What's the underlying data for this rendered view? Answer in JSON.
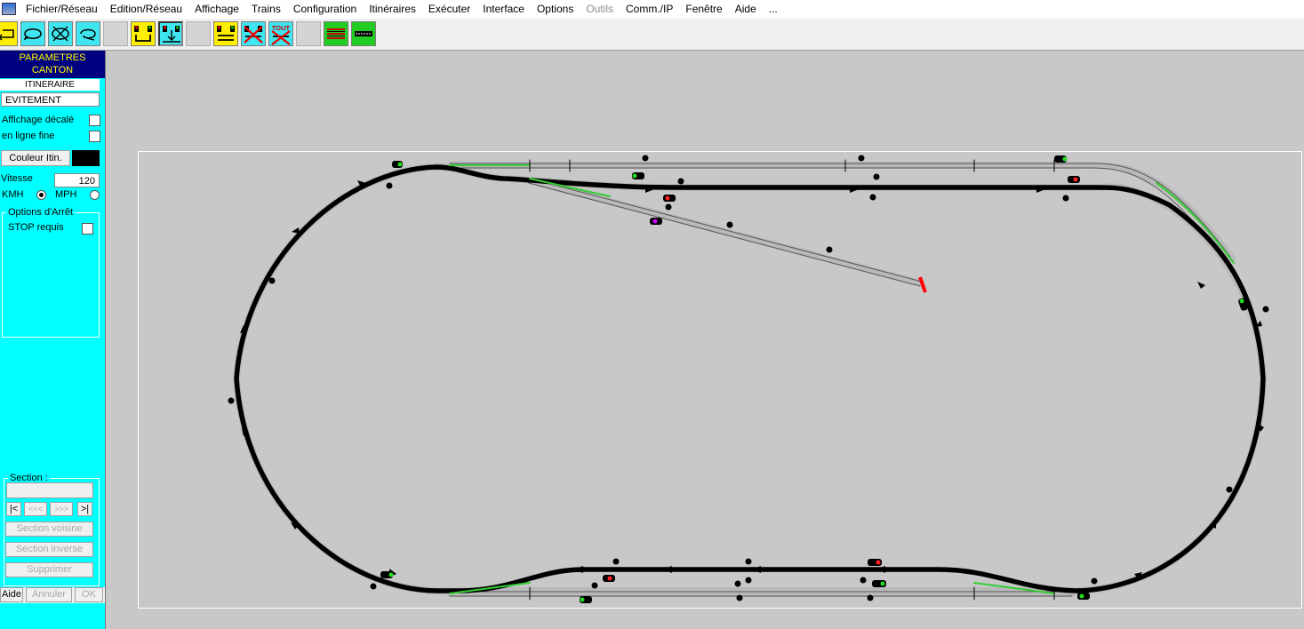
{
  "menu": [
    "Fichier/Réseau",
    "Edition/Réseau",
    "Affichage",
    "Trains",
    "Configuration",
    "Itinéraires",
    "Exécuter",
    "Interface",
    "Options",
    "Outils",
    "Comm./IP",
    "Fenêtre",
    "Aide",
    "..."
  ],
  "menu_disabled": [
    "Outils"
  ],
  "toolbar": {
    "tout_label": "TOUT",
    "buttons": [
      "arrow-loop-icon",
      "loop-icon",
      "loop-crossed-icon",
      "loop-return-icon",
      "blank",
      "signal-pair-icon",
      "signal-pair-down-icon",
      "blank",
      "signal-pair-wide-icon",
      "signal-cancel-icon",
      "tout-cancel-icon",
      "blank",
      "track-lines-icon",
      "track-ruler-icon"
    ]
  },
  "panel": {
    "title_line1": "PARAMETRES",
    "title_line2": "CANTON",
    "itinerary_label": "ITINERAIRE",
    "itinerary_value": "EVITEMENT",
    "affichage_decale": "Affichage décalé",
    "en_ligne_fine": "en ligne fine",
    "couleur_btn": "Couleur Itin.",
    "couleur_value": "#000000",
    "vitesse_label": "Vitesse",
    "vitesse_value": "120",
    "kmh": "KMH",
    "mph": "MPH",
    "speed_unit_selected": "KMH",
    "options_arret": "Options d'Arrêt",
    "stop_requis": "STOP requis",
    "section_label": "Section :",
    "nav_first": "|<",
    "nav_prev": "<<<",
    "nav_next": ">>>",
    "nav_last": ">|",
    "section_voisine": "Section voisine",
    "section_inverse": "Section inverse",
    "supprimer": "Supprimer",
    "aide": "Aide",
    "annuler": "Annuler",
    "ok": "OK"
  },
  "colors": {
    "panel_bg": "#00ffff",
    "panel_header_bg": "#000080",
    "panel_header_fg": "#ffff00",
    "canvas_bg": "#c8c8c8",
    "route_color": "#000000",
    "switch_color": "#33cc33",
    "buffer_color": "#ff0000"
  }
}
